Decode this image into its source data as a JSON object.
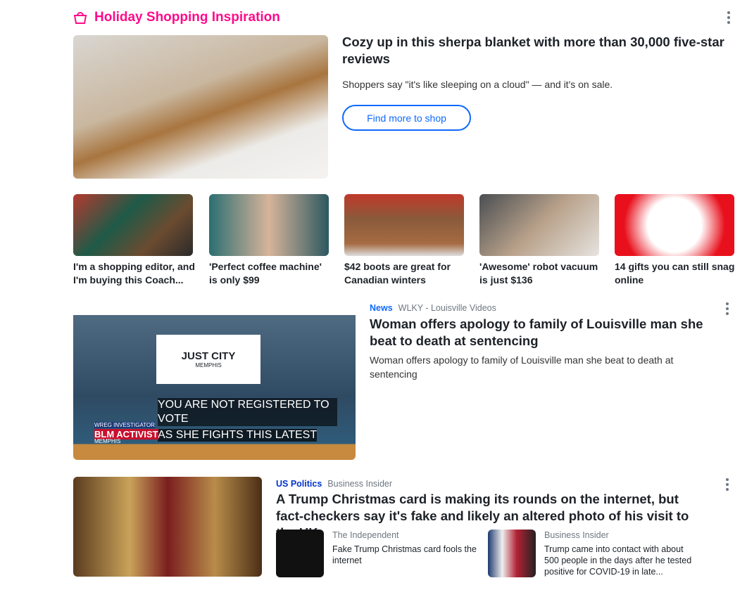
{
  "section": {
    "title": "Holiday Shopping Inspiration",
    "icon": "shopping-bag-icon",
    "accent": "#ff0b8a"
  },
  "hero": {
    "title": "Cozy up in this sherpa blanket with more than 30,000 five-star reviews",
    "summary": "Shoppers say \"it's like sleeping on a cloud\" — and it's on sale.",
    "button": "Find more to shop"
  },
  "thumbs": [
    {
      "caption": "I'm a shopping editor, and I'm buying this Coach..."
    },
    {
      "caption": "'Perfect coffee machine' is only $99"
    },
    {
      "caption": "$42 boots are great for Canadian winters"
    },
    {
      "caption": "'Awesome' robot vacuum is just $136"
    },
    {
      "caption": "14 gifts you can still snag online"
    }
  ],
  "story1": {
    "category": "News",
    "source": "WLKY - Louisville Videos",
    "title": "Woman offers apology to family of Louisville man she beat to death at sentencing",
    "summary": "Woman offers apology to family of Louisville man she beat to death at sentencing",
    "category_color": "#0f69ff",
    "video": {
      "logo": "JUST CITY",
      "logo_sub": "MEMPHIS",
      "caption1": "YOU ARE NOT REGISTERED TO VOTE",
      "caption2": "AS SHE FIGHTS THIS LATEST",
      "lower_third": "BLM ACTIVIST",
      "lower_small": "WREG INVESTIGATOR",
      "lower_city": "MEMPHIS"
    }
  },
  "story2": {
    "category": "US Politics",
    "source": "Business Insider",
    "title": "A Trump Christmas card is making its rounds on the internet, but fact-checkers say it's fake and likely an altered photo of his visit to the UK",
    "category_color": "#0033cc",
    "related": [
      {
        "source": "The Independent",
        "title": "Fake Trump Christmas card fools the internet"
      },
      {
        "source": "Business Insider",
        "title": "Trump came into contact with about 500 people in the days after he tested positive for COVID-19 in late..."
      }
    ]
  }
}
